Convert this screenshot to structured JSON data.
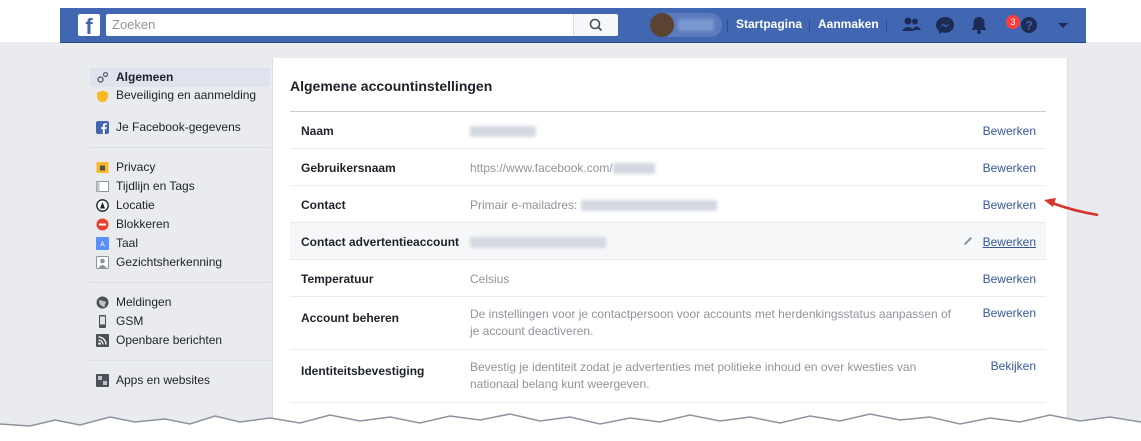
{
  "header": {
    "logo": "f",
    "search_placeholder": "Zoeken",
    "nav_home": "Startpagina",
    "nav_create": "Aanmaken",
    "notification_count": "3"
  },
  "sidebar": {
    "group1": [
      {
        "label": "Algemeen",
        "icon": "gear-icon",
        "active": true
      },
      {
        "label": "Beveiliging en aanmelding",
        "icon": "shield-icon"
      },
      {
        "label": "Je Facebook-gegevens",
        "icon": "facebook-icon"
      }
    ],
    "group2": [
      {
        "label": "Privacy",
        "icon": "lock-icon"
      },
      {
        "label": "Tijdlijn en Tags",
        "icon": "timeline-icon"
      },
      {
        "label": "Locatie",
        "icon": "location-icon"
      },
      {
        "label": "Blokkeren",
        "icon": "block-icon"
      },
      {
        "label": "Taal",
        "icon": "language-icon"
      },
      {
        "label": "Gezichtsherkenning",
        "icon": "face-icon"
      }
    ],
    "group3": [
      {
        "label": "Meldingen",
        "icon": "globe-icon"
      },
      {
        "label": "GSM",
        "icon": "phone-icon"
      },
      {
        "label": "Openbare berichten",
        "icon": "rss-icon"
      }
    ],
    "group4": [
      {
        "label": "Apps en websites",
        "icon": "apps-icon"
      }
    ]
  },
  "main": {
    "title": "Algemene accountinstellingen",
    "rows": [
      {
        "label": "Naam",
        "value": "",
        "action": "Bewerken"
      },
      {
        "label": "Gebruikersnaam",
        "value": "https://www.facebook.com/",
        "action": "Bewerken"
      },
      {
        "label": "Contact",
        "value": "Primair e-mailadres:",
        "action": "Bewerken"
      },
      {
        "label": "Contact advertentieaccount",
        "value": "",
        "action": "Bewerken"
      },
      {
        "label": "Temperatuur",
        "value": "Celsius",
        "action": "Bewerken"
      },
      {
        "label": "Account beheren",
        "value": "De instellingen voor je contactpersoon voor accounts met herdenkingsstatus aanpassen of je account deactiveren.",
        "action": "Bewerken"
      },
      {
        "label": "Identiteitsbevestiging",
        "value": "Bevestig je identiteit zodat je advertenties met politieke inhoud en over kwesties van nationaal belang kunt weergeven.",
        "action": "Bekijken"
      }
    ]
  },
  "colors": {
    "brand": "#4267b2",
    "link": "#365899",
    "arrow": "#d9342b"
  }
}
